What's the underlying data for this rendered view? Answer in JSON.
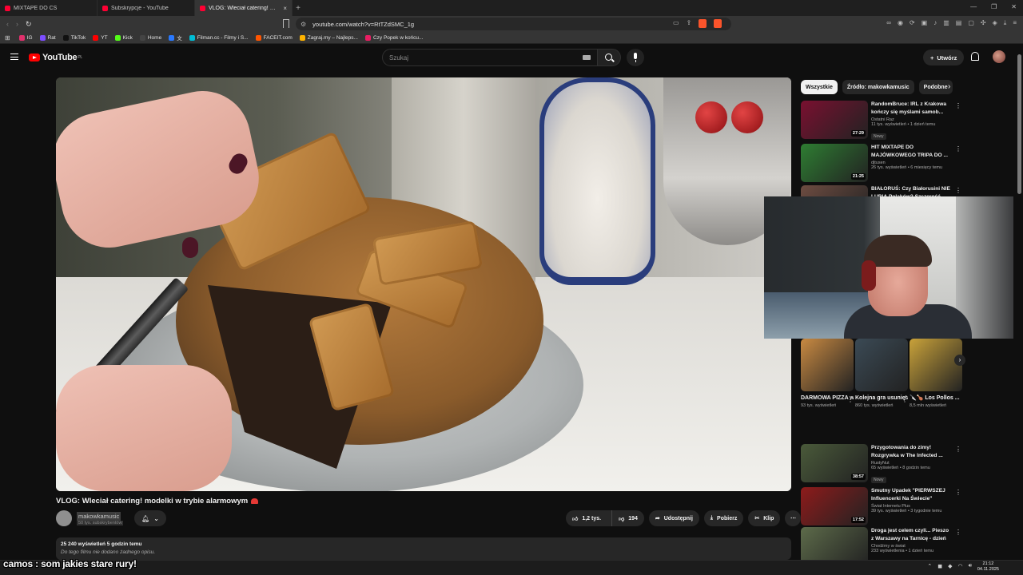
{
  "browser": {
    "tabs": [
      {
        "title": "MIXTAPE DO CS",
        "active": false
      },
      {
        "title": "Subskrypcje - YouTube",
        "active": false
      },
      {
        "title": "VLOG: Wleciał catering! mode",
        "active": true
      }
    ],
    "new_tab": "+",
    "url": "youtube.com/watch?v=RtTZdSMC_1g",
    "bookmarks": [
      {
        "label": "IG",
        "color": "#e1306c"
      },
      {
        "label": "Rat",
        "color": "#7c4dff"
      },
      {
        "label": "TikTok",
        "color": "#111111"
      },
      {
        "label": "YT",
        "color": "#ff0000"
      },
      {
        "label": "Kick",
        "color": "#53fc18"
      },
      {
        "label": "Home",
        "color": "#444444"
      },
      {
        "label": "文",
        "color": "#2979ff"
      },
      {
        "label": "Filman.cc - Filmy i S...",
        "color": "#00bcd4"
      },
      {
        "label": "FACEIT.com",
        "color": "#ff5500"
      },
      {
        "label": "Zagraj.my – Najleps...",
        "color": "#ffb300"
      },
      {
        "label": "Czy Popek w końcu...",
        "color": "#e91e63"
      }
    ]
  },
  "youtube": {
    "logo_text": "YouTube",
    "region": "PL",
    "search_placeholder": "Szukaj",
    "create_label": "Utwórz"
  },
  "video": {
    "title": "VLOG: Wleciał catering! modelki w trybie alarmowym",
    "channel": "makowkamusic",
    "subscribers": "50 tys. subskrybentów",
    "likes": "1,2 tys.",
    "dislikes": "194",
    "share_label": "Udostępnij",
    "download_label": "Pobierz",
    "clip_label": "Klip",
    "stats": "25 240 wyświetleń  5 godzin temu",
    "description": "Do tego filmu nie dodano żadnego opisu."
  },
  "sidebar": {
    "chips": [
      "Wszystkie",
      "Źródło: makowkamusic",
      "Podobne"
    ],
    "recs_top": [
      {
        "title": "RandomBruce: IRL z Krakowa kończy się myślami samob...",
        "channel": "Ostatni Raz",
        "meta": "11 tys. wyświetleń • 1 dzień temu",
        "badge": "Nowy",
        "duration": "27:29",
        "thumb": "#7a1030"
      },
      {
        "title": "HIT MIXTAPE DO MAJÓWKOWEGO TRIPA DO ...",
        "channel": "djtusen",
        "meta": "26 tys. wyświetleń • 6 miesięcy temu",
        "badge": "",
        "duration": "21:25",
        "thumb": "#2e7d32"
      },
      {
        "title": "BIAŁORUŚ: Czy Białorusini NIE LUBIĄ Polaków? Szczerość...",
        "channel": "",
        "meta": "",
        "badge": "",
        "duration": "",
        "thumb": "#6d4c41"
      }
    ],
    "shorts": [
      {
        "title": "DARMOWA PIZZA w ...",
        "views": "93 tys. wyświetleń",
        "thumb": "#c98a42"
      },
      {
        "title": "Kolejna gra usunięta ze...",
        "views": "860 tys. wyświetleń",
        "thumb": "#3b4a55"
      },
      {
        "title": "🔪🍗 Los Pollos ...",
        "views": "8,5 mln wyświetleń",
        "thumb": "#c9a23a"
      }
    ],
    "recs_bottom": [
      {
        "title": "Przygotowania do zimy! Rozgrywka w The Infected ...",
        "channel": "RustyNut",
        "meta": "65 wyświetleń • 8 godzin temu",
        "badge": "Nowy",
        "duration": "38:57",
        "thumb": "#4a5a3a"
      },
      {
        "title": "Smutny Upadek \"PIERWSZEJ Influencerki Na Świecie\"",
        "channel": "Świat Internetu Plus",
        "meta": "39 tys. wyświetleń • 3 tygodnie temu",
        "badge": "",
        "duration": "17:52",
        "thumb": "#8e1b1b"
      },
      {
        "title": "Droga jest celem czyli... Pieszo z Warszawy na Tarnicę - dzień ...",
        "channel": "Chodźmy w świat",
        "meta": "233 wyświetlenia • 1 dzień temu",
        "badge": "",
        "duration": "",
        "thumb": "#5d6b4a"
      }
    ]
  },
  "overlay": {
    "caption": "camos : som jakies stare rury!"
  },
  "taskbar": {
    "time": "21:12",
    "date": "04.11.2025"
  }
}
